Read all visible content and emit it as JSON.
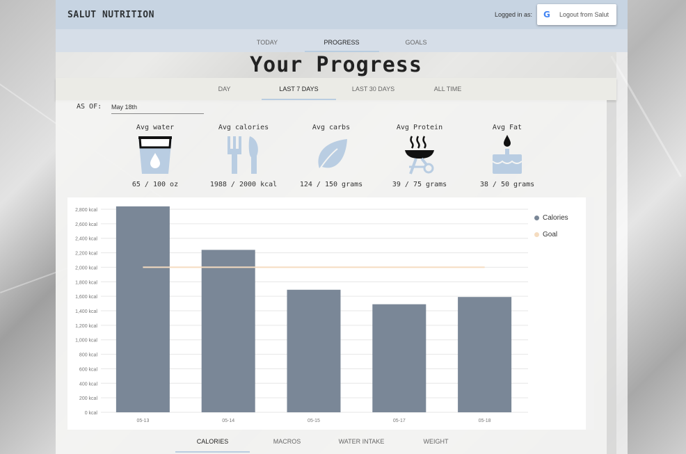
{
  "header": {
    "brand": "SALUT NUTRITION",
    "logged_in_label": "Logged in as:",
    "logout_label": "Logout from Salut"
  },
  "nav": {
    "tabs": [
      {
        "label": "TODAY",
        "active": false
      },
      {
        "label": "PROGRESS",
        "active": true
      },
      {
        "label": "GOALS",
        "active": false
      }
    ]
  },
  "page": {
    "title": "Your Progress",
    "ranges": [
      {
        "label": "DAY",
        "active": false
      },
      {
        "label": "LAST 7 DAYS",
        "active": true
      },
      {
        "label": "LAST 30 DAYS",
        "active": false
      },
      {
        "label": "ALL TIME",
        "active": false
      }
    ],
    "as_of_label": "AS OF:",
    "as_of_value": "May 18th"
  },
  "stats": [
    {
      "label": "Avg water",
      "value": "65 / 100 oz",
      "icon": "water-glass-icon"
    },
    {
      "label": "Avg calories",
      "value": "1988 / 2000 kcal",
      "icon": "fork-knife-icon"
    },
    {
      "label": "Avg carbs",
      "value": "124 / 150 grams",
      "icon": "leaf-icon"
    },
    {
      "label": "Avg Protein",
      "value": "39 / 75 grams",
      "icon": "grill-icon"
    },
    {
      "label": "Avg Fat",
      "value": "38 / 50 grams",
      "icon": "cake-icon"
    }
  ],
  "colors": {
    "bar": "#7a8797",
    "goal": "#f5dcc0",
    "icon": "#b9cde2",
    "accent": "#b9cde0"
  },
  "chart_data": {
    "type": "bar",
    "categories": [
      "05-13",
      "05-14",
      "05-15",
      "05-17",
      "05-18"
    ],
    "series": [
      {
        "name": "Calories",
        "values": [
          2890,
          2240,
          1690,
          1490,
          1590
        ]
      },
      {
        "name": "Goal",
        "type": "line",
        "values": [
          2000,
          2000,
          2000,
          2000,
          2000
        ]
      }
    ],
    "yticks": [
      "0 kcal",
      "200 kcal",
      "400 kcal",
      "600 kcal",
      "800 kcal",
      "1,000 kcal",
      "1,200 kcal",
      "1,400 kcal",
      "1,600 kcal",
      "1,800 kcal",
      "2,000 kcal",
      "2,200 kcal",
      "2,400 kcal",
      "2,600 kcal",
      "2,800 kcal"
    ],
    "ylim": [
      0,
      2800
    ],
    "grid": true,
    "legend": "right"
  },
  "chart_tabs": [
    {
      "label": "CALORIES",
      "active": true
    },
    {
      "label": "MACROS",
      "active": false
    },
    {
      "label": "WATER INTAKE",
      "active": false
    },
    {
      "label": "WEIGHT",
      "active": false
    }
  ]
}
